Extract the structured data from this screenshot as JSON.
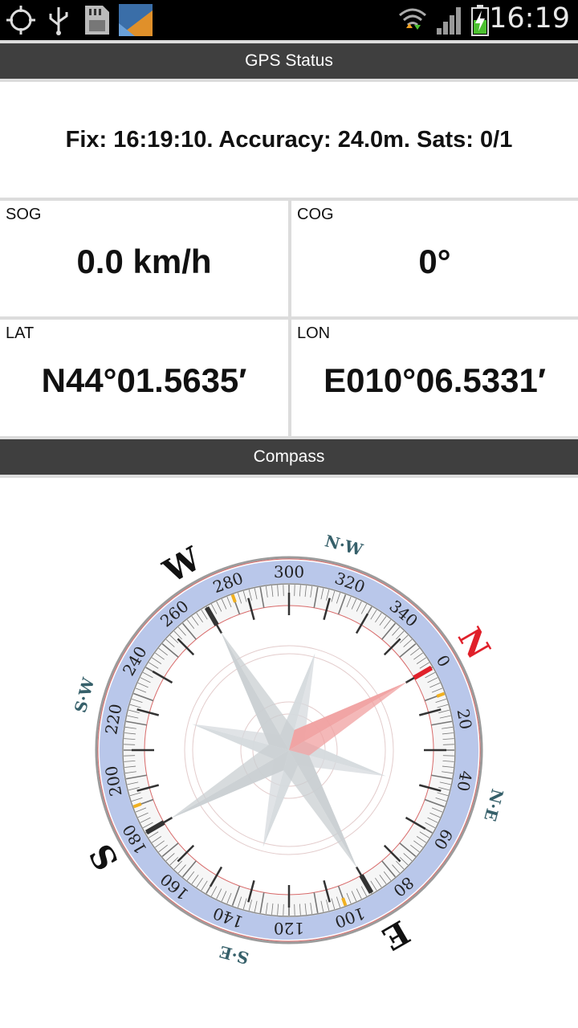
{
  "status_bar": {
    "time": "16:19",
    "left_icons": [
      "gps-icon",
      "usb-icon",
      "sd-card-icon",
      "app-thumbnail-icon"
    ],
    "right_icons": [
      "wifi-icon",
      "signal-icon",
      "battery-charging-icon"
    ]
  },
  "gps_section": {
    "title": "GPS Status",
    "fix_text": "Fix: 16:19:10. Accuracy: 24.0m. Sats: 0/1"
  },
  "readings": {
    "sog": {
      "label": "SOG",
      "value": "0.0 km/h"
    },
    "cog": {
      "label": "COG",
      "value": "0°"
    },
    "lat": {
      "label": "LAT",
      "value": "N44°01.5635′"
    },
    "lon": {
      "label": "LON",
      "value": "E010°06.5331′"
    }
  },
  "compass_section": {
    "title": "Compass",
    "rotation_deg": 60,
    "cardinals": {
      "N": "N",
      "E": "E",
      "S": "S",
      "W": "W"
    },
    "intercardinals": {
      "NE": "N·E",
      "SE": "S·E",
      "SW": "S·W",
      "NW": "N·W"
    },
    "degree_labels": [
      "0",
      "20",
      "40",
      "60",
      "80",
      "100",
      "120",
      "140",
      "160",
      "180",
      "200",
      "220",
      "240",
      "260",
      "280",
      "300",
      "320",
      "340"
    ],
    "colors": {
      "north": "#e0202a",
      "ring": "#b9c7ea",
      "rose": "#c9cfd2",
      "tick": "#333333"
    }
  }
}
